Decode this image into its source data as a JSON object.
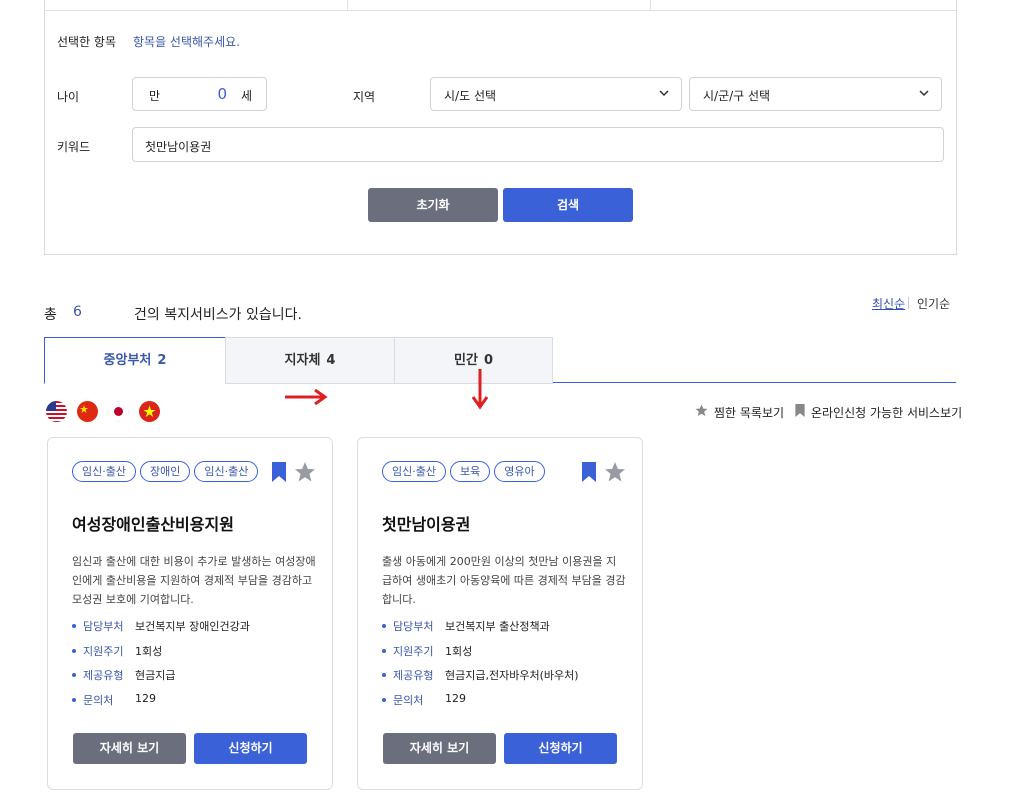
{
  "filter": {
    "selected_label": "선택한 항목",
    "selected_hint": "항목을 선택해주세요.",
    "age_label": "나이",
    "age_prefix": "만",
    "age_value": "0",
    "age_suffix": "세",
    "region_label": "지역",
    "province_select": "시/도 선택",
    "city_select": "시/군/구 선택",
    "keyword_label": "키워드",
    "keyword_value": "첫만남이용권",
    "reset_label": "초기화",
    "search_label": "검색"
  },
  "results": {
    "total_prefix": "총",
    "total_count": "6",
    "total_suffix": "건의 복지서비스가 있습니다.",
    "sort_recent": "최신순",
    "sort_popular": "인기순"
  },
  "tabs": [
    {
      "label": "중앙부처",
      "count": "2",
      "active": true
    },
    {
      "label": "지자체",
      "count": "4",
      "active": false
    },
    {
      "label": "민간",
      "count": "0",
      "active": false
    }
  ],
  "languages": [
    "us-flag-icon",
    "china-flag-icon",
    "japan-flag-icon",
    "vietnam-flag-icon"
  ],
  "util_links": {
    "favorites": "찜한 목록보기",
    "online": "온라인신청 가능한 서비스보기"
  },
  "cards": [
    {
      "tags": [
        "임신·출산",
        "장애인",
        "임신·출산"
      ],
      "title": "여성장애인출산비용지원",
      "description": "임신과 출산에 대한 비용이 추가로 발생하는 여성장애인에게 출산비용을 지원하여 경제적 부담을 경감하고 모성권 보호에 기여합니다.",
      "info": [
        {
          "key": "담당부처",
          "value": "보건복지부 장애인건강과"
        },
        {
          "key": "지원주기",
          "value": "1회성"
        },
        {
          "key": "제공유형",
          "value": "현금지급"
        },
        {
          "key": "문의처",
          "value": "129"
        }
      ],
      "detail_label": "자세히 보기",
      "apply_label": "신청하기"
    },
    {
      "tags": [
        "임신·출산",
        "보육",
        "영유아"
      ],
      "title": "첫만남이용권",
      "description": "출생 아동에게 200만원 이상의 첫만남 이용권을 지급하여 생애초기 아동양육에 따른 경제적 부담을 경감합니다.",
      "info": [
        {
          "key": "담당부처",
          "value": "보건복지부 출산정책과"
        },
        {
          "key": "지원주기",
          "value": "1회성"
        },
        {
          "key": "제공유형",
          "value": "현금지급,전자바우처(바우처)"
        },
        {
          "key": "문의처",
          "value": "129"
        }
      ],
      "detail_label": "자세히 보기",
      "apply_label": "신청하기"
    }
  ],
  "colors": {
    "accent": "#3b61d8",
    "accent_text": "#3a57a8",
    "neutral_button": "#6b6f7d",
    "annotation_arrow": "#e02020"
  }
}
